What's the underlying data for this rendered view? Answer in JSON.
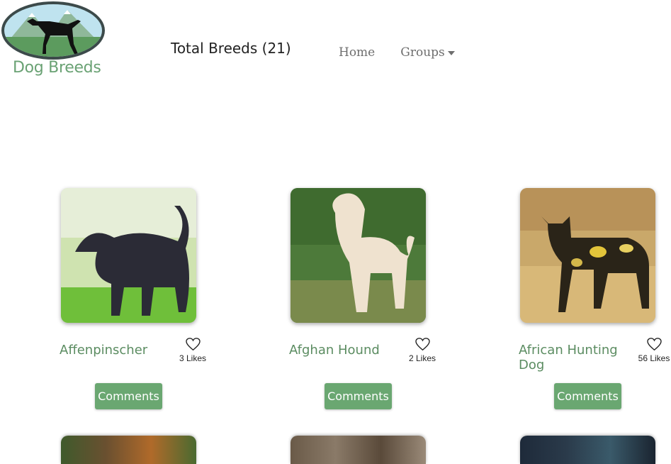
{
  "header": {
    "logo_text": "Dog Breeds",
    "total_label": "Total Breeds (21)"
  },
  "nav": {
    "home": "Home",
    "groups": "Groups"
  },
  "breeds": [
    {
      "name": "Affenpinscher",
      "likes": "3 Likes",
      "comments_label": "Comments"
    },
    {
      "name": "Afghan Hound",
      "likes": "2 Likes",
      "comments_label": "Comments"
    },
    {
      "name": "African Hunting Dog",
      "likes": "56 Likes",
      "comments_label": "Comments"
    }
  ],
  "colors": {
    "accent": "#6aa771",
    "breed_name": "#5b8c61",
    "nav_text": "#6e6e6e"
  }
}
